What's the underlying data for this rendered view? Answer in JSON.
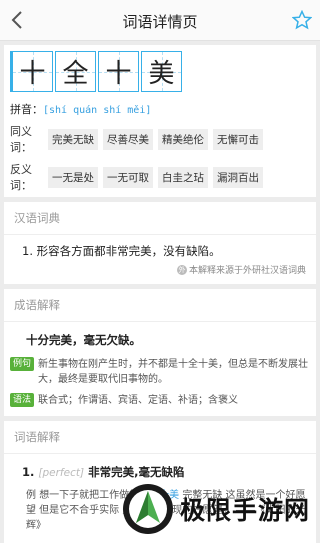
{
  "header": {
    "title": "词语详情页",
    "back_icon": "chevron-left-icon",
    "star_icon": "star-outline-icon"
  },
  "word": {
    "chars": [
      "十",
      "全",
      "十",
      "美"
    ],
    "pinyin_label": "拼音：",
    "pinyin": "[shí quán shí měi]",
    "synonyms_label": "同义词：",
    "synonyms": [
      "完美无缺",
      "尽善尽美",
      "精美绝伦",
      "无懈可击"
    ],
    "antonyms_label": "反义词：",
    "antonyms": [
      "一无是处",
      "一无可取",
      "白圭之玷",
      "漏洞百出"
    ]
  },
  "hanyu": {
    "title": "汉语词典",
    "definition": "1. 形容各方面都非常完美，没有缺陷。",
    "source": "本解释来源于外研社汉语词典"
  },
  "chengyu": {
    "title": "成语解释",
    "main": "十分完美，毫无欠缺。",
    "example_badge": "例句",
    "example": "新生事物在刚产生时，并不都是十全十美，但总是不断发展壮大，最终是要取代旧事物的。",
    "grammar_badge": "语法",
    "grammar": "联合式；作谓语、宾语、定语、补语；含褒义"
  },
  "ciyu": {
    "title": "词语解释",
    "num": "1.",
    "eng": "[perfect]",
    "main": "非常完美,毫无缺陷",
    "ex_label": "例",
    "ex_before": "想一下子就把工作做得",
    "ex_highlight": "十全十美",
    "ex_after": "完整无缺 这虽然是一个好愿望 但是它不合乎实际 是个没法实现的好愿望。 ——《太阳的光辉》"
  },
  "watermark": {
    "text": "极限手游网"
  }
}
